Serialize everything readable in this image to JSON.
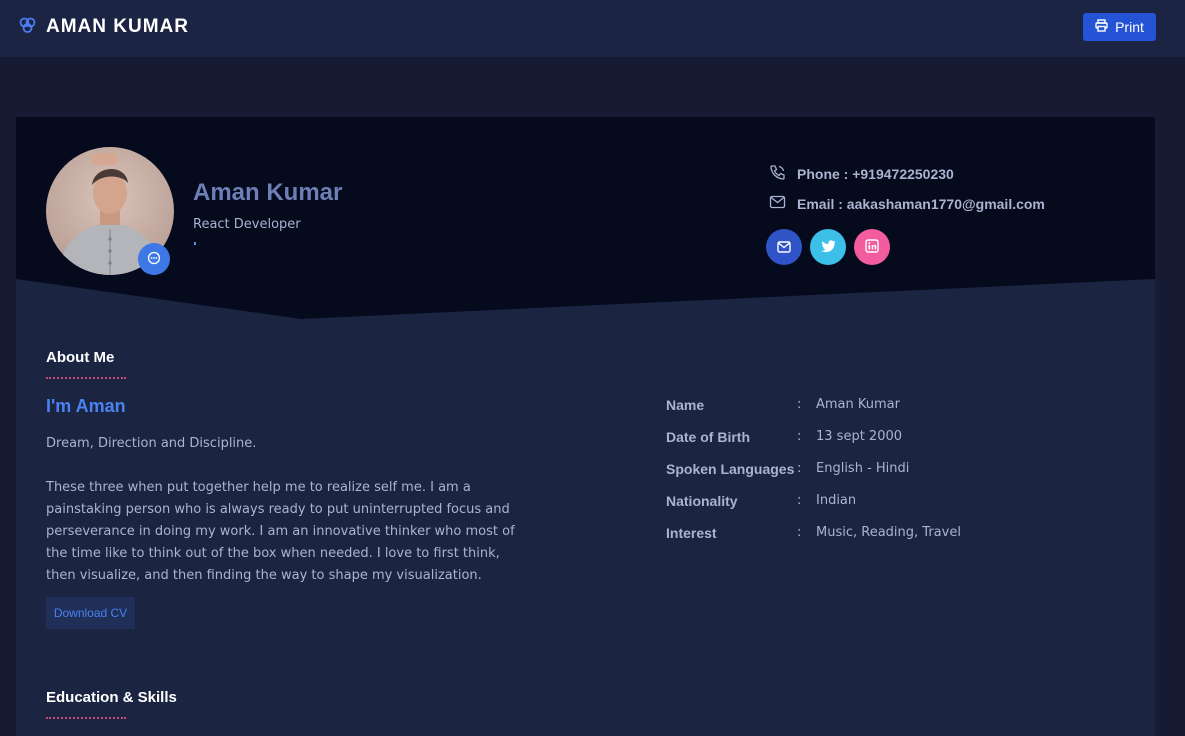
{
  "header": {
    "brand_icon": "logo-icon",
    "brand_name": "AMAN KUMAR",
    "print_label": "Print",
    "print_icon": "printer-icon"
  },
  "profile": {
    "name": "Aman Kumar",
    "role": "React Developer",
    "avatar_badge_icon": "chat-icon",
    "phone": "Phone : +919472250230",
    "email": "Email : aakashaman1770@gmail.com",
    "socials": [
      {
        "icon": "mail-icon",
        "color": "#2f54c8"
      },
      {
        "icon": "twitter-icon",
        "color": "#3cc0ea"
      },
      {
        "icon": "linkedin-icon",
        "color": "#f45ca0"
      }
    ]
  },
  "about": {
    "section_title": "About Me",
    "heading": "I'm Aman",
    "tagline": "Dream, Direction and Discipline.",
    "paragraph": "These three when put together help me to realize self me. I am a painstaking person who is always ready to put uninterrupted focus and perseverance in doing my work. I am an innovative thinker who most of the time like to think out of the box when needed. I love to first think, then visualize, and then finding the way to shape my visualization.",
    "download_label": "Download CV"
  },
  "info": [
    {
      "label": "Name",
      "value": "Aman Kumar"
    },
    {
      "label": "Date of Birth",
      "value": "13 sept 2000"
    },
    {
      "label": "Spoken Languages",
      "value": "English - Hindi"
    },
    {
      "label": "Nationality",
      "value": "Indian"
    },
    {
      "label": "Interest",
      "value": "Music, Reading, Travel"
    }
  ],
  "education": {
    "section_title": "Education & Skills"
  },
  "colors": {
    "accent": "#2453d6",
    "heading_blue": "#4a82f0",
    "underline": "#c44a6a"
  }
}
